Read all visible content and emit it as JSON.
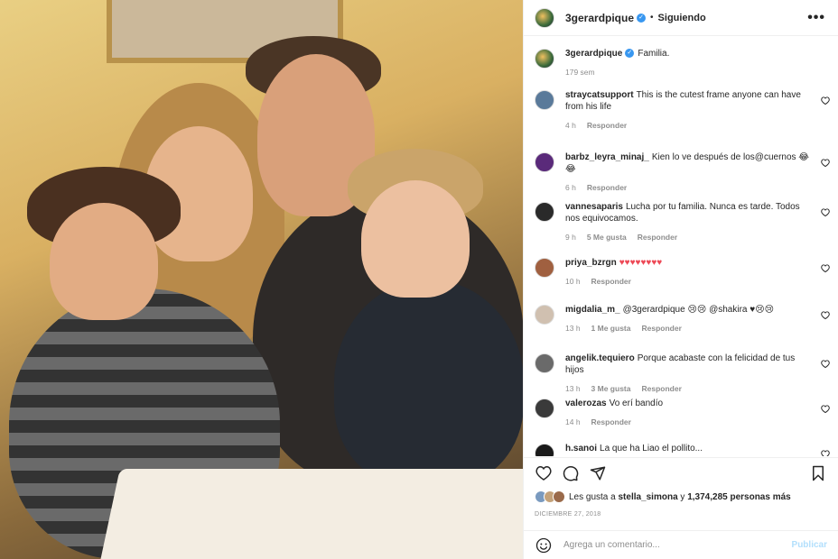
{
  "header": {
    "username": "3gerardpique",
    "verified": "✓",
    "separator": "•",
    "follow_status": "Siguiendo",
    "more": "•••"
  },
  "caption": {
    "username": "3gerardpique",
    "text": "Familia.",
    "time": "179 sem"
  },
  "comments": [
    {
      "user": "straycatsupport",
      "text": "This is the cutest frame anyone can have from his life",
      "time": "4 h",
      "likes": "",
      "reply": "Responder"
    },
    {
      "user": "barbz_leyra_minaj_",
      "text": "Kien lo ve después de los@cuernos 😂😂",
      "time": "6 h",
      "likes": "",
      "reply": "Responder"
    },
    {
      "user": "vannesaparis",
      "text": "Lucha por tu familia. Nunca es tarde. Todos nos equivocamos.",
      "time": "9 h",
      "likes": "5 Me gusta",
      "reply": "Responder"
    },
    {
      "user": "priya_bzrgn",
      "text": "♥♥♥♥♥♥♥♥",
      "time": "10 h",
      "likes": "",
      "reply": "Responder",
      "red": true
    },
    {
      "user": "migdalia_m_",
      "text": "@3gerardpique 😢😢 @shakira ♥😢😢",
      "time": "13 h",
      "likes": "1 Me gusta",
      "reply": "Responder"
    },
    {
      "user": "angelik.tequiero",
      "text": "Porque acabaste con la felicidad de tus hijos",
      "time": "13 h",
      "likes": "3 Me gusta",
      "reply": "Responder"
    },
    {
      "user": "valerozas",
      "text": "Vo erí bandío",
      "time": "14 h",
      "likes": "",
      "reply": "Responder"
    },
    {
      "user": "h.sanoi",
      "text": "La que ha Liao el pollito...",
      "time": "",
      "likes": "",
      "reply": ""
    }
  ],
  "likes_text": "Les gusta a stella_simona y 1,374,285 personas más",
  "likes": {
    "prefix": "Les gusta a ",
    "user": "stella_simona",
    "middle": " y ",
    "count": "1,374,285 personas más"
  },
  "date": "DICIEMBRE 27, 2018",
  "add_comment": {
    "placeholder": "Agrega un comentario...",
    "publish": "Publicar"
  },
  "colors": {
    "accent": "#0095f6",
    "heart_red": "#ed4956",
    "publish_disabled": "#b2dffc"
  },
  "icons": [
    "heart-icon",
    "comment-icon",
    "share-icon",
    "bookmark-icon",
    "emoji-icon",
    "more-icon"
  ]
}
